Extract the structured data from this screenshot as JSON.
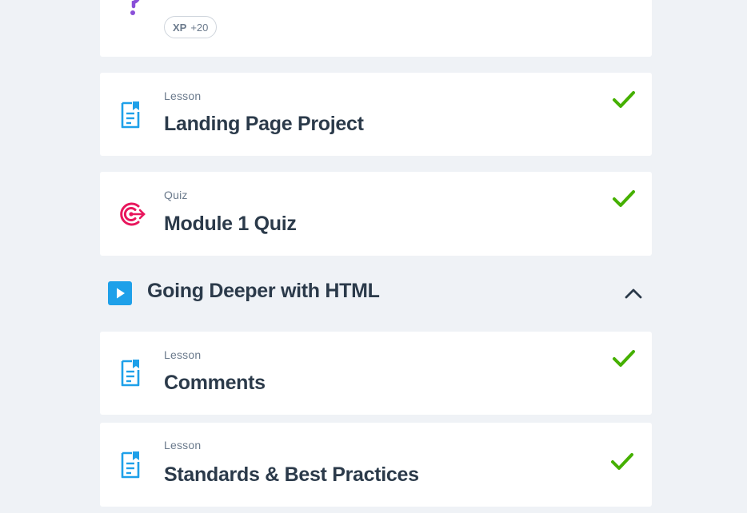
{
  "colors": {
    "background": "#eff2f6",
    "card": "#ffffff",
    "title_text": "#2b3a4a",
    "meta_text": "#6b7a8c",
    "lesson_icon": "#1ea0e9",
    "quiz_icon": "#e8175d",
    "question_icon": "#8a4fd8",
    "check": "#45b000",
    "play_badge": "#1ea0e9"
  },
  "top_card": {
    "icon": "question-mark-icon",
    "xp_label": "XP",
    "xp_value": "+20"
  },
  "items": [
    {
      "kind": "Lesson",
      "title": "Landing Page Project",
      "icon": "lesson-document-icon",
      "completed": true
    },
    {
      "kind": "Quiz",
      "title": "Module 1 Quiz",
      "icon": "quiz-target-icon",
      "completed": true
    }
  ],
  "section": {
    "title": "Going Deeper with HTML",
    "icon": "play-icon",
    "expanded": true,
    "items": [
      {
        "kind": "Lesson",
        "title": "Comments",
        "icon": "lesson-document-icon",
        "completed": true
      },
      {
        "kind": "Lesson",
        "title": "Standards & Best Practices",
        "icon": "lesson-document-icon",
        "completed": true
      }
    ]
  }
}
